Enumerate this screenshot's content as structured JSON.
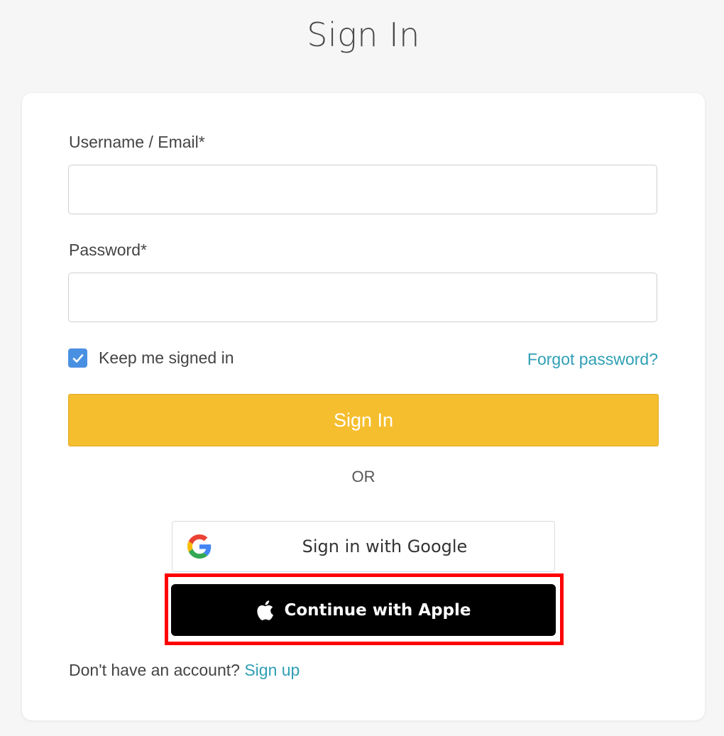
{
  "page": {
    "title": "Sign In"
  },
  "form": {
    "username_label": "Username / Email*",
    "username_value": "",
    "password_label": "Password*",
    "password_value": "",
    "remember_label": "Keep me signed in",
    "remember_checked": true,
    "forgot_link": "Forgot password?",
    "submit_label": "Sign In"
  },
  "divider": {
    "text": "OR"
  },
  "social": {
    "google_label": "Sign in with Google",
    "google_icon": "google-g-icon",
    "apple_label": "Continue with Apple",
    "apple_icon": "apple-logo-icon",
    "apple_highlighted": true
  },
  "footer": {
    "prompt": "Don't have an account?",
    "signup_link": "Sign up"
  },
  "colors": {
    "accent_yellow": "#f5be2e",
    "link_teal": "#2f9fb5",
    "checkbox_blue": "#4a90e2",
    "highlight_red": "#ff0000"
  }
}
